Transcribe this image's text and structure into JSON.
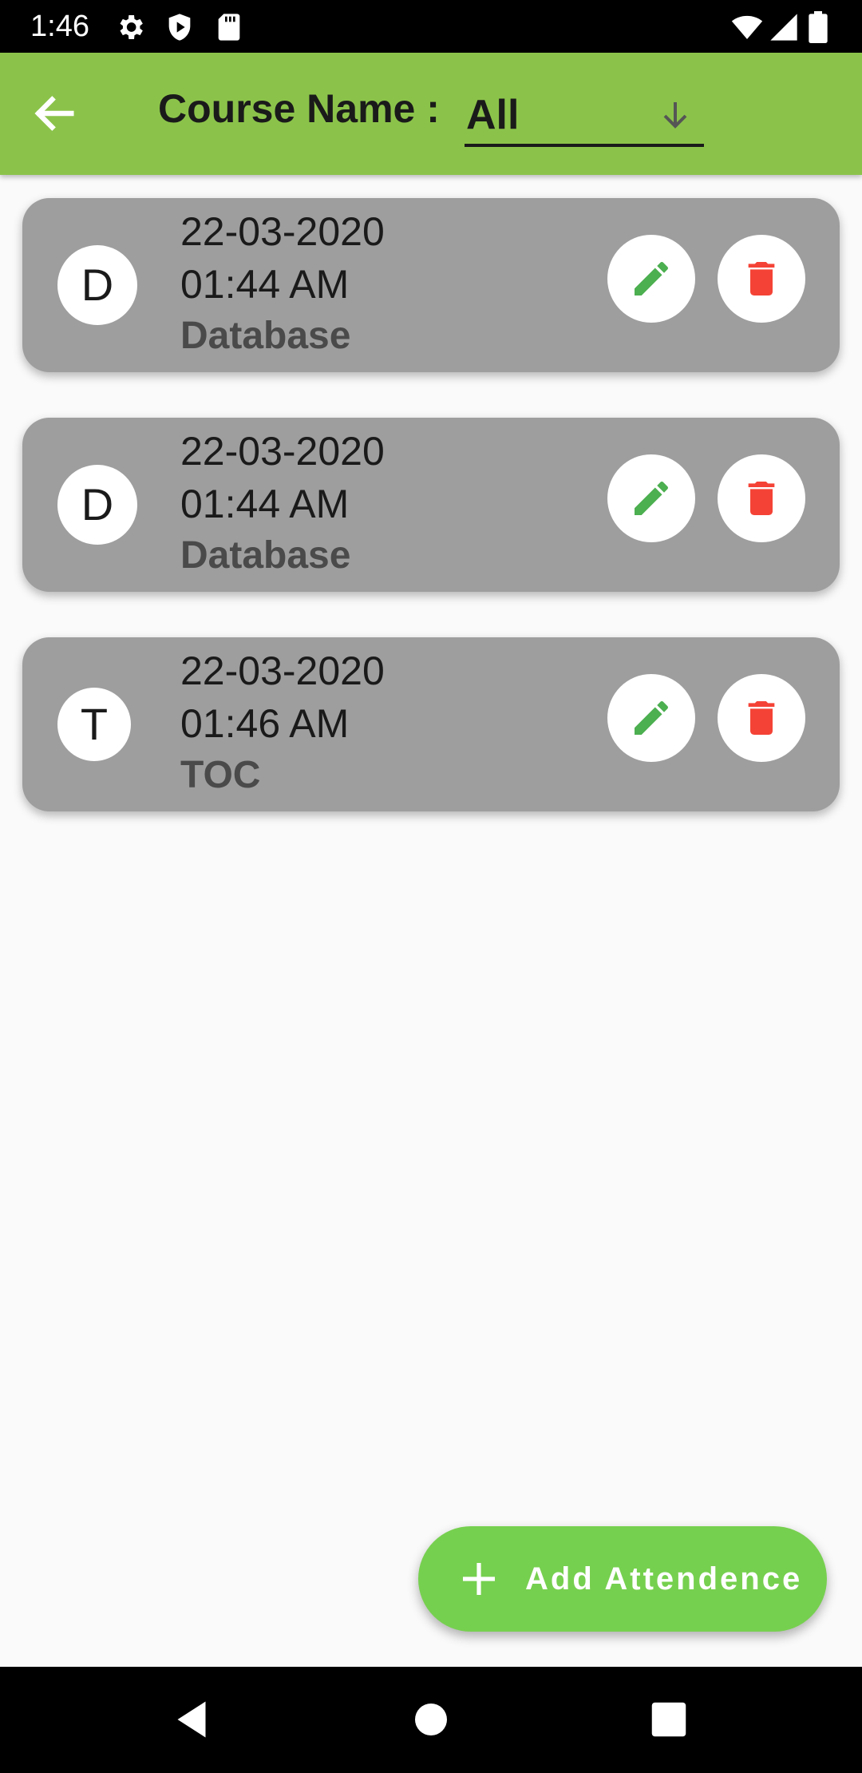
{
  "status_bar": {
    "time": "1:46",
    "icons": [
      "settings-icon",
      "play-protect-icon",
      "sd-card-icon",
      "wifi-icon",
      "signal-icon",
      "battery-icon"
    ]
  },
  "app_bar": {
    "color": "#8bc34a",
    "back_icon": "arrow-back-icon",
    "label": "Course Name :",
    "selected_course": "All",
    "dropdown_icon": "arrow-down-icon"
  },
  "attendance": [
    {
      "initial": "D",
      "date": "22-03-2020",
      "time": "01:44 AM",
      "course": "Database"
    },
    {
      "initial": "D",
      "date": "22-03-2020",
      "time": "01:44 AM",
      "course": "Database"
    },
    {
      "initial": "T",
      "date": "22-03-2020",
      "time": "01:46 AM",
      "course": "TOC"
    }
  ],
  "actions": {
    "edit_icon": "pencil-icon",
    "edit_color": "#4caf50",
    "delete_icon": "trash-icon",
    "delete_color": "#f44336",
    "card_color": "#9e9e9e"
  },
  "fab": {
    "icon": "plus-icon",
    "label": "Add Attendence",
    "color": "#76d04f"
  },
  "nav_bar": {
    "items": [
      "back-nav-icon",
      "home-nav-icon",
      "recents-nav-icon"
    ]
  }
}
